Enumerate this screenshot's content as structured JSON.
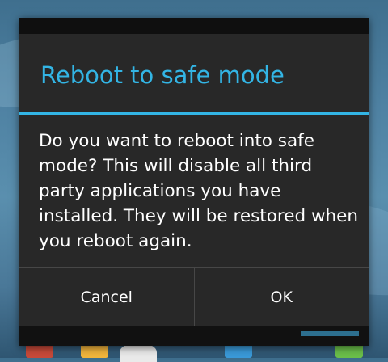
{
  "dialog": {
    "title": "Reboot to safe mode",
    "message": "Do you want to reboot into safe mode? This will disable all third party applications you have installed. They will be restored when you reboot again.",
    "cancel_label": "Cancel",
    "ok_label": "OK"
  },
  "colors": {
    "accent": "#33b5e5",
    "dialog_background": "#282828",
    "text": "#ffffff"
  }
}
